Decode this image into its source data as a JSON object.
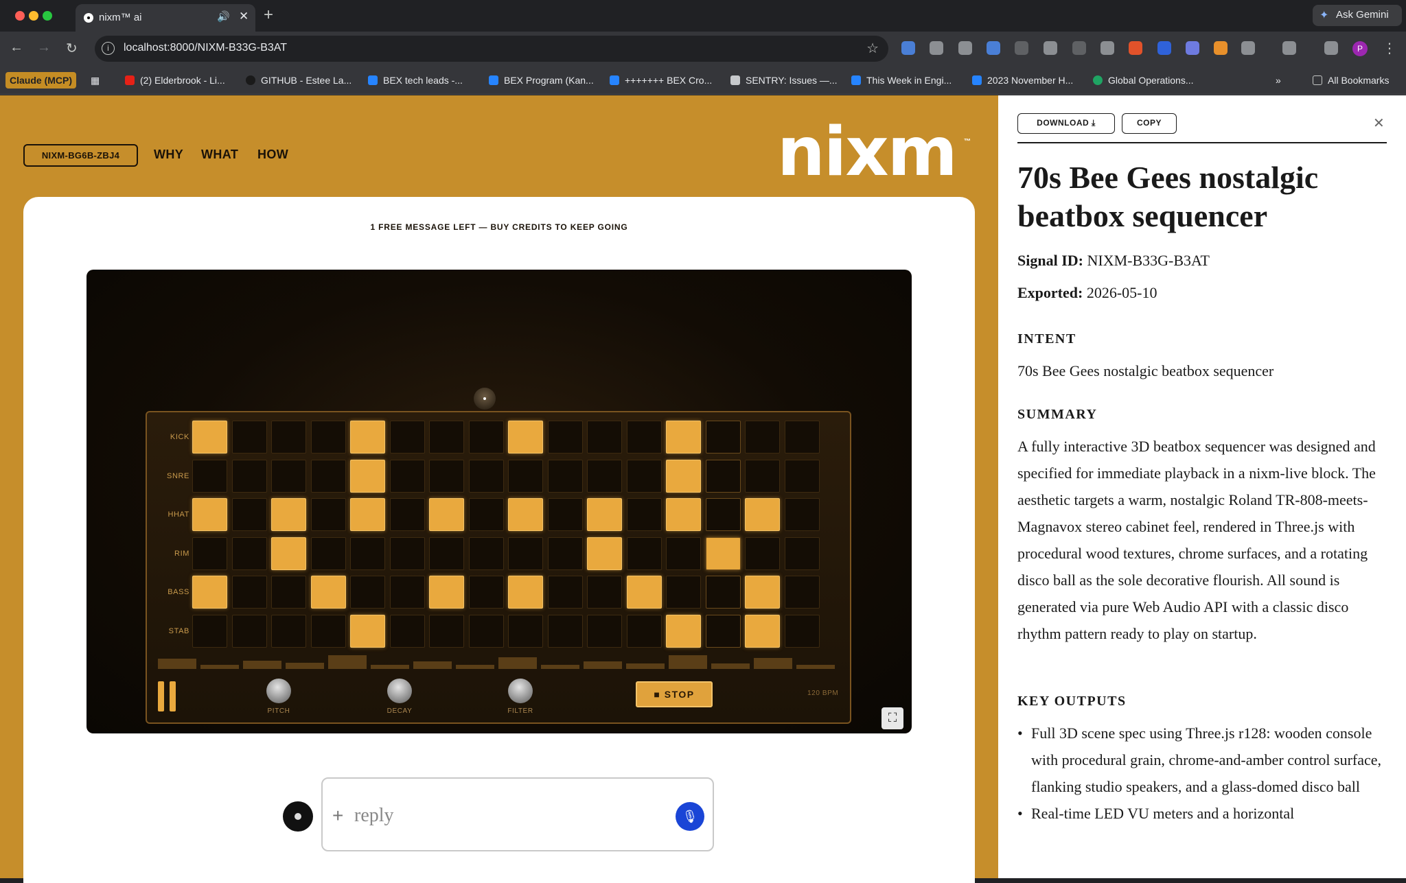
{
  "browser": {
    "tab_title": "nixm™ ai",
    "url": "localhost:8000/NIXM-B33G-B3AT",
    "gemini_label": "Ask Gemini",
    "profile_initial": "P",
    "bookmarks": [
      "Claude (MCP)",
      "(2) Elderbrook - Li...",
      "GITHUB - Estee La...",
      "BEX tech leads -...",
      "BEX Program (Kan...",
      "+++++++ BEX Cro...",
      "SENTRY: Issues —...",
      "This Week in Engi...",
      "2023 November H...",
      "Global Operations...",
      "All Bookmarks"
    ]
  },
  "app": {
    "signal_pill": "NIXM-BG6B-ZBJ4",
    "nav": [
      "WHY",
      "WHAT",
      "HOW"
    ],
    "logo": "nixm",
    "logo_tm": "™",
    "credits_notice": "1 FREE MESSAGE LEFT — BUY CREDITS TO KEEP GOING",
    "reply_placeholder": "reply"
  },
  "sequencer": {
    "rows": [
      {
        "label": "KICK",
        "steps": [
          1,
          0,
          0,
          0,
          1,
          0,
          0,
          0,
          1,
          0,
          0,
          0,
          1,
          0,
          0,
          0
        ]
      },
      {
        "label": "SNRE",
        "steps": [
          0,
          0,
          0,
          0,
          1,
          0,
          0,
          0,
          0,
          0,
          0,
          0,
          1,
          0,
          0,
          0
        ]
      },
      {
        "label": "HHAT",
        "steps": [
          1,
          0,
          1,
          0,
          1,
          0,
          1,
          0,
          1,
          0,
          1,
          0,
          1,
          0,
          1,
          0
        ]
      },
      {
        "label": "RIM",
        "steps": [
          0,
          0,
          1,
          0,
          0,
          0,
          0,
          0,
          0,
          0,
          1,
          0,
          0,
          1,
          0,
          0
        ]
      },
      {
        "label": "BASS",
        "steps": [
          1,
          0,
          0,
          1,
          0,
          0,
          1,
          0,
          1,
          0,
          0,
          1,
          0,
          0,
          1,
          0
        ]
      },
      {
        "label": "STAB",
        "steps": [
          0,
          0,
          0,
          0,
          1,
          0,
          0,
          0,
          0,
          0,
          0,
          0,
          1,
          0,
          1,
          0
        ]
      }
    ],
    "current_step": 13,
    "knobs": [
      "PITCH",
      "DECAY",
      "FILTER"
    ],
    "stop_label": "■ STOP",
    "bpm_label": "120 BPM"
  },
  "panel": {
    "download_label": "DOWNLOAD ⤓",
    "copy_label": "COPY",
    "title": "70s Bee Gees nostalgic beatbox sequencer",
    "signal_id_label": "Signal ID:",
    "signal_id": "NIXM-B33G-B3AT",
    "exported_label": "Exported:",
    "exported": "2026-05-10",
    "intent_heading": "INTENT",
    "intent": "70s Bee Gees nostalgic beatbox sequencer",
    "summary_heading": "SUMMARY",
    "summary": "A fully interactive 3D beatbox sequencer was designed and specified for immediate playback in a nixm-live block. The aesthetic targets a warm, nostalgic Roland TR-808-meets-Magnavox stereo cabinet feel, rendered in Three.js with procedural wood textures, chrome surfaces, and a rotating disco ball as the sole decorative flourish. All sound is generated via pure Web Audio API with a classic disco rhythm pattern ready to play on startup.",
    "outputs_heading": "KEY OUTPUTS",
    "outputs": [
      "Full 3D scene spec using Three.js r128: wooden console with procedural grain, chrome-and-amber control surface, flanking studio speakers, and a glass-domed disco ball",
      "Real-time LED VU meters and a horizontal"
    ]
  }
}
